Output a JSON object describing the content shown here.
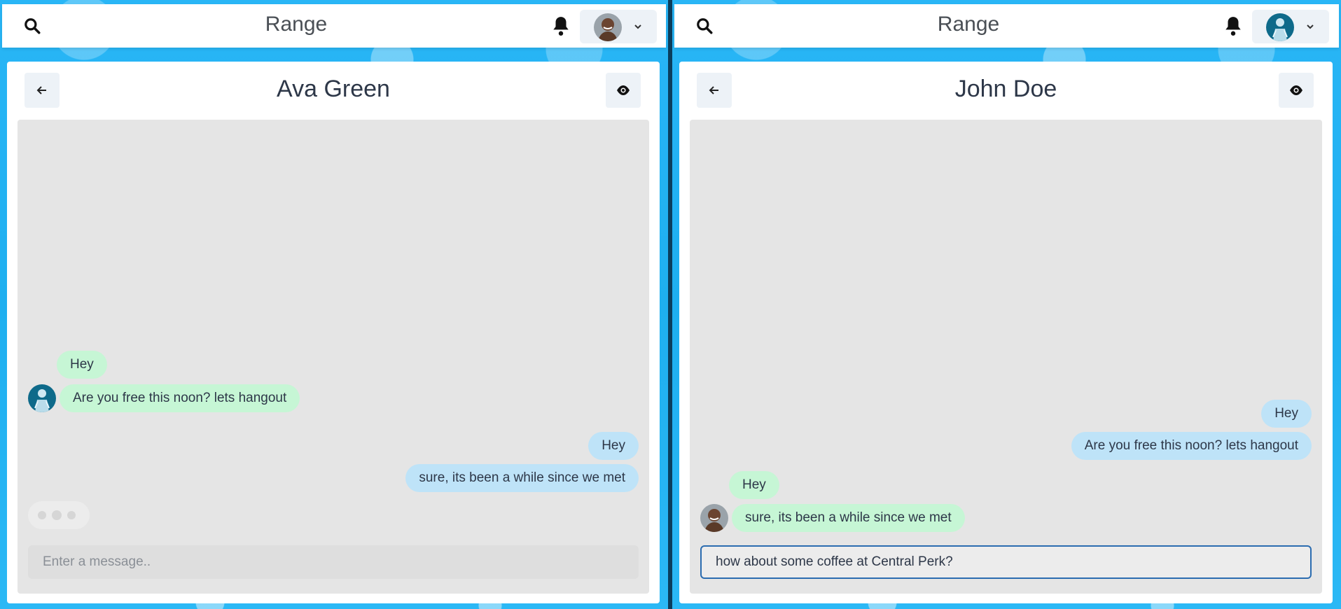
{
  "left": {
    "brand": "Range",
    "chat_title": "Ava Green",
    "messages_received": [
      "Hey",
      "Are you free this noon? lets hangout"
    ],
    "messages_sent": [
      "Hey",
      "sure, its been a while since we met"
    ],
    "input_placeholder": "Enter a message..",
    "input_value": "",
    "typing_indicator": true,
    "user_avatar": "man-avatar",
    "contact_avatar": "blue-figure-avatar"
  },
  "right": {
    "brand": "Range",
    "chat_title": "John Doe",
    "messages_sent": [
      "Hey",
      "Are you free this noon? lets hangout"
    ],
    "messages_received": [
      "Hey",
      "sure, its been a while since we met"
    ],
    "input_placeholder": "",
    "input_value": "how about some coffee at Central Perk?",
    "user_avatar": "blue-figure-avatar",
    "contact_avatar": "man-avatar"
  },
  "colors": {
    "background": "#29b6f6",
    "sent_bubble": "#bee3f8",
    "received_bubble": "#c6f6d5",
    "chat_area": "#e5e5e5",
    "focus_border": "#2b6cb0"
  },
  "icons": [
    "search-icon",
    "bell-icon",
    "chevron-down-icon",
    "arrow-left-icon",
    "eye-icon"
  ]
}
